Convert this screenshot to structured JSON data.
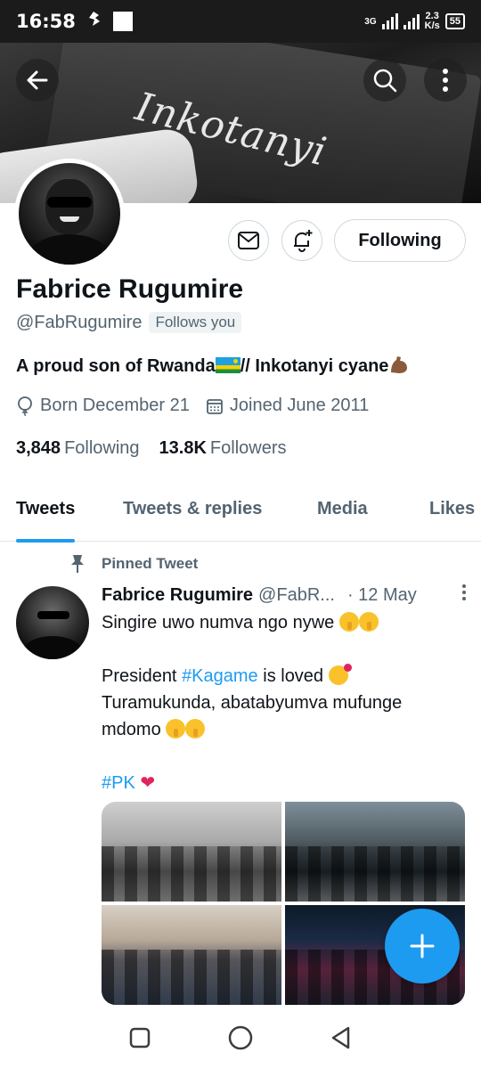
{
  "status_bar": {
    "time": "16:58",
    "network_type": "3G",
    "net_speed_value": "2.3",
    "net_speed_unit": "K/s",
    "battery": "55"
  },
  "banner": {
    "text": "Inkotanyi"
  },
  "profile": {
    "name": "Fabrice Rugumire",
    "handle": "@FabRugumire",
    "follows_you": "Follows you",
    "following_button": "Following",
    "bio_part1": "A proud son of Rwanda",
    "bio_part2": "// Inkotanyi cyane",
    "born": "Born December 21",
    "joined": "Joined June 2011",
    "following_count": "3,848",
    "following_label": "Following",
    "followers_count": "13.8K",
    "followers_label": "Followers"
  },
  "tabs": {
    "tweets": "Tweets",
    "replies": "Tweets & replies",
    "media": "Media",
    "likes": "Likes"
  },
  "tweet": {
    "pinned_label": "Pinned Tweet",
    "author_name": "Fabrice Rugumire",
    "author_handle": "@FabR...",
    "date": "· 12 May",
    "line1": "Singire uwo numva ngo nywe",
    "line3_prefix": "President ",
    "line3_hashtag": "#Kagame",
    "line3_suffix": " is loved",
    "line4": "Turamukunda, abatabyumva mufunge",
    "line5": "mdomo",
    "hashtag2": "#PK"
  },
  "colors": {
    "accent": "#1d9bf0",
    "secondary_text": "#536471",
    "heart": "#e0245e"
  }
}
